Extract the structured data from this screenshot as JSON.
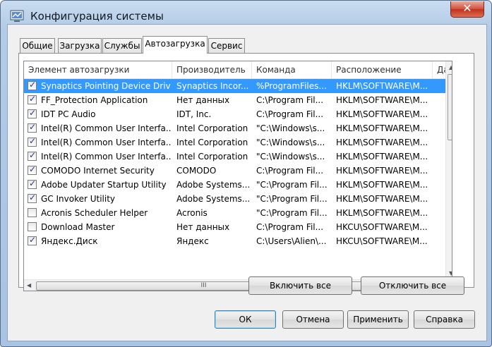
{
  "window": {
    "title": "Конфигурация системы",
    "close_symbol": "✕"
  },
  "tabs": [
    "Общие",
    "Загрузка",
    "Службы",
    "Автозагрузка",
    "Сервис"
  ],
  "active_tab": "Автозагрузка",
  "columns": [
    "Элемент автозагрузки",
    "Производитель",
    "Команда",
    "Расположение",
    "Да"
  ],
  "rows": [
    {
      "checked": true,
      "name": "Synaptics Pointing Device Driver",
      "vendor": "Synaptics Incor...",
      "command": "%ProgramFiles...",
      "location": "HKLM\\SOFTWARE\\M...",
      "selected": true
    },
    {
      "checked": true,
      "name": "FF_Protection Application",
      "vendor": "Нет данных",
      "command": "C:\\Program Fil...",
      "location": "HKLM\\SOFTWARE\\M..."
    },
    {
      "checked": true,
      "name": "IDT PC Audio",
      "vendor": "IDT, Inc.",
      "command": "C:\\Program Fil...",
      "location": "HKLM\\SOFTWARE\\M..."
    },
    {
      "checked": true,
      "name": "Intel(R) Common User Interfa...",
      "vendor": "Intel Corporation",
      "command": "\"C:\\Windows\\s...",
      "location": "HKLM\\SOFTWARE\\M..."
    },
    {
      "checked": true,
      "name": "Intel(R) Common User Interfa...",
      "vendor": "Intel Corporation",
      "command": "\"C:\\Windows\\s...",
      "location": "HKLM\\SOFTWARE\\M..."
    },
    {
      "checked": true,
      "name": "Intel(R) Common User Interfa...",
      "vendor": "Intel Corporation",
      "command": "\"C:\\Windows\\s...",
      "location": "HKLM\\SOFTWARE\\M..."
    },
    {
      "checked": true,
      "name": "COMODO Internet Security",
      "vendor": "COMODO",
      "command": "C:\\Program Fil...",
      "location": "HKLM\\SOFTWARE\\M..."
    },
    {
      "checked": true,
      "name": "Adobe Updater Startup Utility",
      "vendor": "Adobe Systems...",
      "command": "\"C:\\Program Fil...",
      "location": "HKLM\\SOFTWARE\\M..."
    },
    {
      "checked": true,
      "name": "GC Invoker Utility",
      "vendor": "Adobe Systems...",
      "command": "\"C:\\Program Fil...",
      "location": "HKLM\\SOFTWARE\\M..."
    },
    {
      "checked": false,
      "name": "Acronis Scheduler Helper",
      "vendor": "Acronis",
      "command": "\"C:\\Program Fil...",
      "location": "HKLM\\SOFTWARE\\M..."
    },
    {
      "checked": false,
      "name": "Download Master",
      "vendor": "Нет данных",
      "command": "C:\\Program Fil...",
      "location": "HKCU\\SOFTWARE\\M..."
    },
    {
      "checked": true,
      "name": "Яндекс.Диск",
      "vendor": "Яндекс",
      "command": "C:\\Users\\Alien\\...",
      "location": "HKCU\\SOFTWARE\\M..."
    }
  ],
  "buttons": {
    "enable_all": "Включить все",
    "disable_all": "Отключить все",
    "ok": "ОК",
    "cancel": "Отмена",
    "apply": "Применить",
    "help": "Справка"
  },
  "scroll": {
    "h_thumb_grip": "III",
    "up": "▲",
    "down": "▼",
    "left": "◀",
    "right": "▶"
  }
}
